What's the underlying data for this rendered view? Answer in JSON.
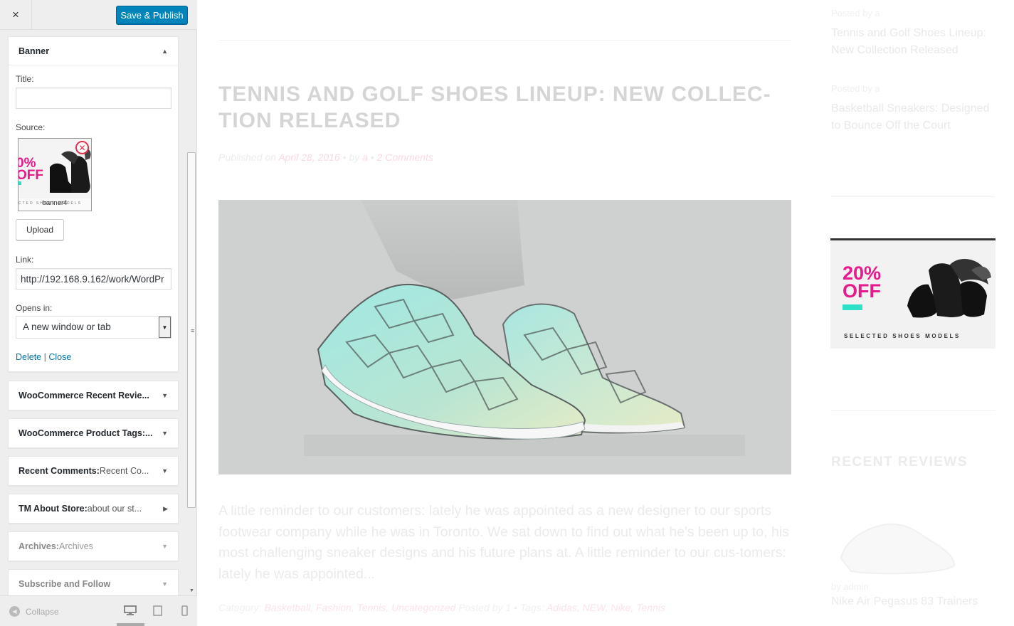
{
  "header": {
    "close_icon": "×",
    "save_label": "Save & Publish"
  },
  "banner_widget": {
    "title": "Banner",
    "title_label": "Title:",
    "title_value": "",
    "source_label": "Source:",
    "thumbnail_caption": "banner4",
    "thumbnail_strip": "CTED SHOES MODELS",
    "thumbnail_pct": "0% OFF",
    "upload_label": "Upload",
    "link_label": "Link:",
    "link_value": "http://192.168.9.162/work/WordPr",
    "opens_label": "Opens in:",
    "opens_value": "A new window or tab",
    "delete_label": "Delete",
    "separator": "|",
    "close_label": "Close"
  },
  "widgets": [
    {
      "name": "WooCommerce Recent Revie...",
      "sub": ""
    },
    {
      "name": "WooCommerce Product Tags:...",
      "sub": ""
    },
    {
      "name": "Recent Comments:",
      "sub": " Recent Co..."
    },
    {
      "name": "TM About Store:",
      "sub": " about our st..."
    },
    {
      "name": "Archives:",
      "sub": " Archives"
    },
    {
      "name": "Subscribe and Follow",
      "sub": ""
    }
  ],
  "footer": {
    "collapse_label": "Collapse"
  },
  "preview": {
    "post_title": "TENNIS AND GOLF SHOES LINEUP: NEW COLLEC-TION RELEASED",
    "meta": {
      "published_on": "Published on ",
      "date": "April 28, 2016",
      "by": " • by ",
      "author": "a",
      "dot": " • ",
      "comments": "2 Comments"
    },
    "excerpt": "A little reminder to our customers: lately he was appointed as a new designer to our sports footwear company while he was in Toronto. We sat down to find out what he's been up to, his most challenging sneaker designs and his future plans at. A little reminder to our cus-tomers: lately he was appointed...",
    "categories_label": "Category: ",
    "categories": "Basketball, Fashion, Tennis, Uncategorized",
    "posted_in_extra": " Posted by 1 • Tags: ",
    "tags": "Adidas, NEW, Nike, Tennis"
  },
  "sidebar": {
    "posts": [
      {
        "posted": "Posted by a",
        "title": "Tennis and Golf Shoes Lineup: New Collection Released"
      },
      {
        "posted": "Posted by a",
        "title": "Basketball Sneakers: Designed to Bounce Off the Court"
      }
    ],
    "banner_pct": "20% OFF",
    "banner_tagline": "SELECTED SHOES MODELS",
    "recent_reviews_heading": "RECENT REVIEWS",
    "review_byline": "by admin",
    "review_title": "Nike Air Pegasus 83 Trainers"
  },
  "colors": {
    "primary_button": "#0085ba",
    "link": "#0073aa",
    "accent_pink": "#e8198b",
    "accent_teal": "#2de0c6"
  }
}
